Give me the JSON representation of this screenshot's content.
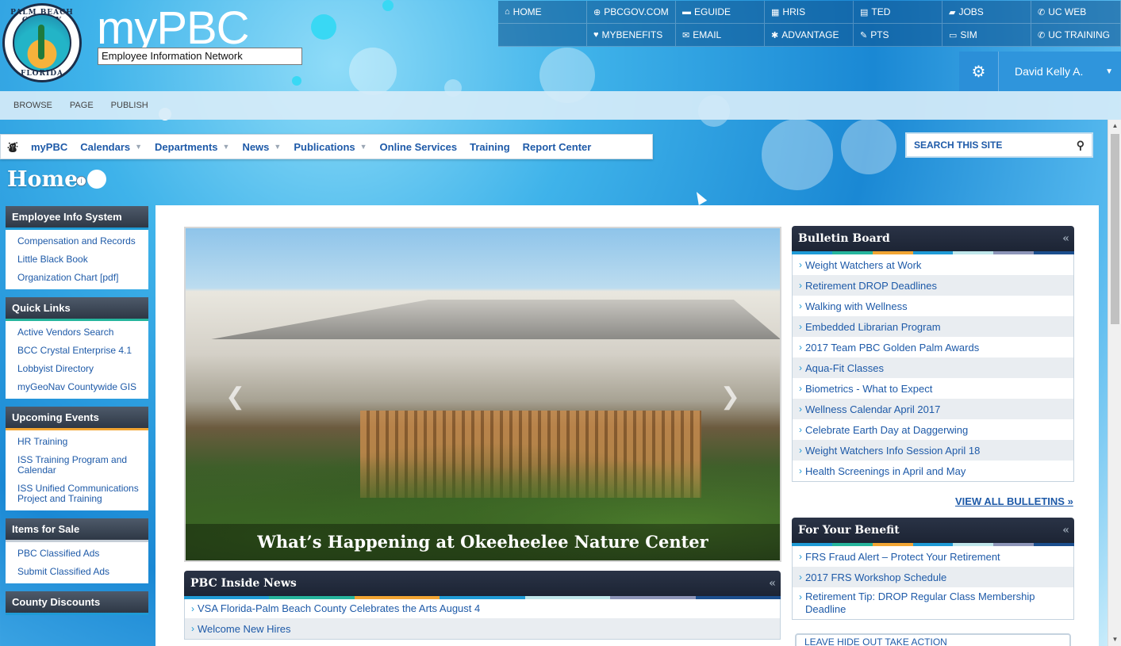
{
  "brand": {
    "name": "myPBC",
    "tagline": "Employee Information Network",
    "seal_top": "PALM BEACH COUNTY",
    "seal_bottom": "FLORIDA"
  },
  "topnav": [
    {
      "label": "HOME",
      "icon": "home-icon",
      "glyph": "⌂"
    },
    {
      "label": "PBCGOV.COM",
      "icon": "globe-icon",
      "glyph": "⊕"
    },
    {
      "label": "EGUIDE",
      "icon": "book-icon",
      "glyph": "▬"
    },
    {
      "label": "HRIS",
      "icon": "calendar-icon",
      "glyph": "▦"
    },
    {
      "label": "TED",
      "icon": "notebook-icon",
      "glyph": "▤"
    },
    {
      "label": "JOBS",
      "icon": "briefcase-icon",
      "glyph": "▰"
    },
    {
      "label": "UC WEB",
      "icon": "phone-icon",
      "glyph": "✆"
    },
    {
      "label": "",
      "icon": "",
      "glyph": ""
    },
    {
      "label": "MYBENEFITS",
      "icon": "heart-icon",
      "glyph": "♥"
    },
    {
      "label": "EMAIL",
      "icon": "envelope-icon",
      "glyph": "✉"
    },
    {
      "label": "ADVANTAGE",
      "icon": "asterisk-icon",
      "glyph": "✱"
    },
    {
      "label": "PTS",
      "icon": "pin-icon",
      "glyph": "✎"
    },
    {
      "label": "SIM",
      "icon": "keyboard-icon",
      "glyph": "▭"
    },
    {
      "label": "UC TRAINING",
      "icon": "phone-icon",
      "glyph": "✆"
    }
  ],
  "user": {
    "name": "David Kelly A."
  },
  "ribbon": [
    "BROWSE",
    "PAGE",
    "PUBLISH"
  ],
  "sitenav": [
    {
      "label": "myPBC",
      "caret": false
    },
    {
      "label": "Calendars",
      "caret": true
    },
    {
      "label": "Departments",
      "caret": true
    },
    {
      "label": "News",
      "caret": true
    },
    {
      "label": "Publications",
      "caret": true
    },
    {
      "label": "Online Services",
      "caret": false
    },
    {
      "label": "Training",
      "caret": false
    },
    {
      "label": "Report Center",
      "caret": false
    }
  ],
  "search": {
    "placeholder": "SEARCH THIS SITE"
  },
  "page": {
    "title": "Home"
  },
  "leftrail": [
    {
      "title": "Employee Info System",
      "items": [
        "Compensation and Records",
        "Little Black Book",
        "Organization Chart [pdf]"
      ]
    },
    {
      "title": "Quick Links",
      "items": [
        "Active Vendors Search",
        "BCC Crystal Enterprise 4.1",
        "Lobbyist Directory",
        "myGeoNav Countywide GIS"
      ]
    },
    {
      "title": "Upcoming Events",
      "items": [
        "HR Training",
        "ISS Training Program and Calendar",
        "ISS Unified Communications Project and Training"
      ]
    },
    {
      "title": "Items for Sale",
      "items": [
        "PBC Classified Ads",
        "Submit Classified Ads"
      ]
    },
    {
      "title": "County Discounts",
      "items": []
    }
  ],
  "slider": {
    "caption": "What’s Happening at Okeeheelee Nature Center"
  },
  "bulletin": {
    "title": "Bulletin Board",
    "items": [
      "Weight Watchers at Work",
      "Retirement DROP Deadlines",
      "Walking with Wellness",
      "Embedded Librarian Program",
      "2017 Team PBC Golden Palm Awards",
      "Aqua-Fit Classes",
      "Biometrics - What to Expect",
      "Wellness Calendar April 2017",
      "Celebrate Earth Day at Daggerwing",
      "Weight Watchers Info Session April 18",
      "Health Screenings in April and May"
    ],
    "view_all": "VIEW ALL BULLETINS"
  },
  "benefit": {
    "title": "For Your Benefit",
    "items": [
      "FRS Fraud Alert – Protect Your Retirement",
      "2017 FRS Workshop Schedule",
      "Retirement Tip: DROP Regular Class Membership Deadline"
    ]
  },
  "inside": {
    "title": "PBC Inside News",
    "items": [
      "VSA Florida-Palm Beach County Celebrates the Arts August 4",
      "Welcome New Hires"
    ]
  },
  "peek": {
    "label": "LEAVE HIDE OUT TAKE ACTION"
  },
  "colors": {
    "strip": [
      "#1f9bd6",
      "#26b59d",
      "#f2a533",
      "#1f9bd6",
      "#bfe6ea",
      "#8d95b8",
      "#1c4f8e"
    ]
  }
}
